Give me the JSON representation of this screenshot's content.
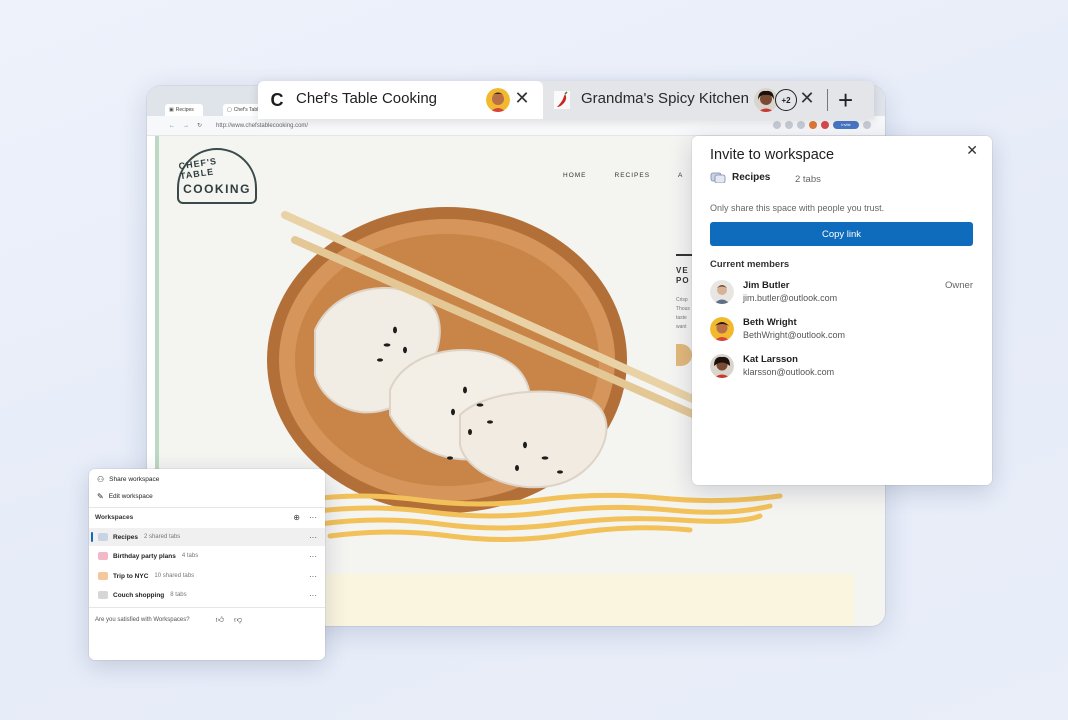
{
  "tabs": [
    {
      "favicon": "C",
      "title": "Chef's Table Cooking",
      "close": "✕"
    },
    {
      "favicon": "chili-pepper",
      "title": "Grandma's Spicy Kitchen",
      "extra_members": "+2",
      "close": "✕"
    }
  ],
  "new_tab": "+",
  "browser": {
    "mini_tabs": [
      "Recipes",
      "Chef's Table"
    ],
    "url": "http://www.chefstablecooking.com/",
    "invite_chip": "Invite"
  },
  "site": {
    "logo_top": "CHEF'S TABLE",
    "logo_bottom": "COOKING",
    "nav": [
      "HOME",
      "RECIPES",
      "A"
    ],
    "hero_title": [
      "VE",
      "PO"
    ],
    "hero_body": [
      "Crisp",
      "Thous",
      "taste",
      "want"
    ]
  },
  "invite_panel": {
    "title": "Invite to workspace",
    "close": "✕",
    "workspace_name": "Recipes",
    "workspace_count": "2 tabs",
    "trust_note": "Only share this space with people you trust.",
    "copy_link": "Copy link",
    "members_heading": "Current members",
    "members": [
      {
        "name": "Jim Butler",
        "email": "jim.butler@outlook.com",
        "role": "Owner"
      },
      {
        "name": "Beth Wright",
        "email": "BethWright@outlook.com",
        "role": ""
      },
      {
        "name": "Kat Larsson",
        "email": "klarsson@outlook.com",
        "role": ""
      }
    ]
  },
  "workspaces_panel": {
    "share": "Share workspace",
    "edit": "Edit workspace",
    "heading": "Workspaces",
    "items": [
      {
        "name": "Recipes",
        "count": "2 shared tabs",
        "color": "#c9d3e6"
      },
      {
        "name": "Birthday party plans",
        "count": "4 tabs",
        "color": "#f2b8c6"
      },
      {
        "name": "Trip to NYC",
        "count": "10 shared tabs",
        "color": "#f6c79a"
      },
      {
        "name": "Couch shopping",
        "count": "8 tabs",
        "color": "#d6d6d6"
      }
    ],
    "more": "···",
    "feedback": "Are you satisfied with Workspaces?"
  },
  "colors": {
    "accent": "#0f6cbd",
    "wood": "#c6844a",
    "cream": "#faf5df",
    "yellow_brush": "#f2c15a"
  }
}
